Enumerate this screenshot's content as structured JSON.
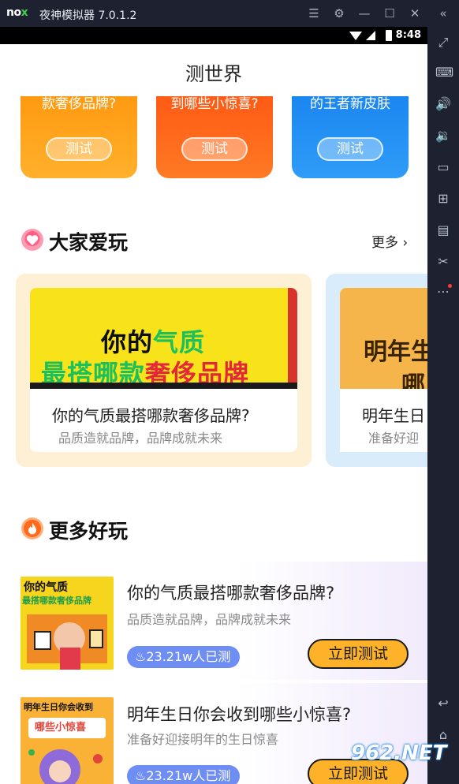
{
  "window": {
    "logo": "nox",
    "title": "夜神模拟器 7.0.1.2"
  },
  "statusbar": {
    "time": "8:48"
  },
  "page": {
    "title": "测世界"
  },
  "top_cards": [
    {
      "text": "款奢侈品牌?",
      "button": "测试",
      "color": "#ff9f1a"
    },
    {
      "text": "到哪些小惊喜?",
      "button": "测试",
      "color": "#ff6a1c"
    },
    {
      "text": "的王者新皮肤",
      "button": "测试",
      "color": "#1f8ef3"
    }
  ],
  "popular": {
    "title": "大家爱玩",
    "more": "更多",
    "cards": [
      {
        "banner_line1": "你的",
        "banner_line1_accent": "气质",
        "banner_line2": "最搭哪款",
        "banner_line2_accent": "奢侈品牌",
        "title": "你的气质最搭哪款奢侈品牌?",
        "subtitle": "品质造就品牌，品牌成就未来"
      },
      {
        "banner_line1": "明年生",
        "banner_line2": "哪",
        "title": "明年生日",
        "subtitle": "准备好迎"
      }
    ]
  },
  "more_fun": {
    "title": "更多好玩",
    "items": [
      {
        "title": "你的气质最搭哪款奢侈品牌?",
        "subtitle": "品质造就品牌，品牌成就未来",
        "badge": "23.21w人已测",
        "button": "立即测试",
        "thumb_line1": "你的气质",
        "thumb_line2": "最搭哪款奢侈品牌"
      },
      {
        "title": "明年生日你会收到哪些小惊喜?",
        "subtitle": "准备好迎接明年的生日惊喜",
        "badge": "23.21w人已测",
        "button": "立即测试",
        "thumb_line1": "明年生日你会收到",
        "thumb_line2": "哪些小惊喜"
      }
    ]
  },
  "watermark": "962.NET"
}
